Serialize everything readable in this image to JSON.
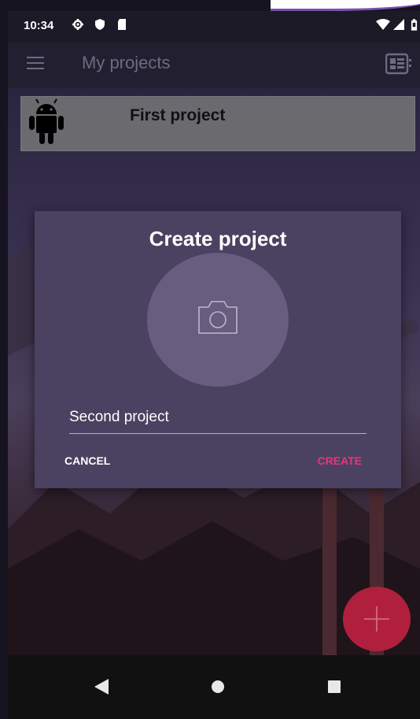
{
  "status_bar": {
    "time": "10:34",
    "icons": [
      "gear-icon",
      "shield-icon",
      "sd-card-icon",
      "wifi-icon",
      "signal-icon",
      "battery-icon"
    ]
  },
  "app_bar": {
    "title": "My projects",
    "icons": [
      "menu-icon",
      "view-toggle-icon"
    ]
  },
  "projects": [
    {
      "name": "First project",
      "icon": "android-icon"
    }
  ],
  "dialog": {
    "title": "Create project",
    "photo_icon": "camera-icon",
    "input_value": "Second project",
    "cancel_label": "CANCEL",
    "create_label": "CREATE"
  },
  "fab": {
    "icon": "plus-icon"
  },
  "nav_bar": {
    "icons": [
      "back-icon",
      "home-icon",
      "recents-icon"
    ]
  },
  "colors": {
    "accent": "#e4387a",
    "fab": "#b0203e",
    "dialog_bg": "#4b4160",
    "app_bar_bg": "#211f30"
  }
}
